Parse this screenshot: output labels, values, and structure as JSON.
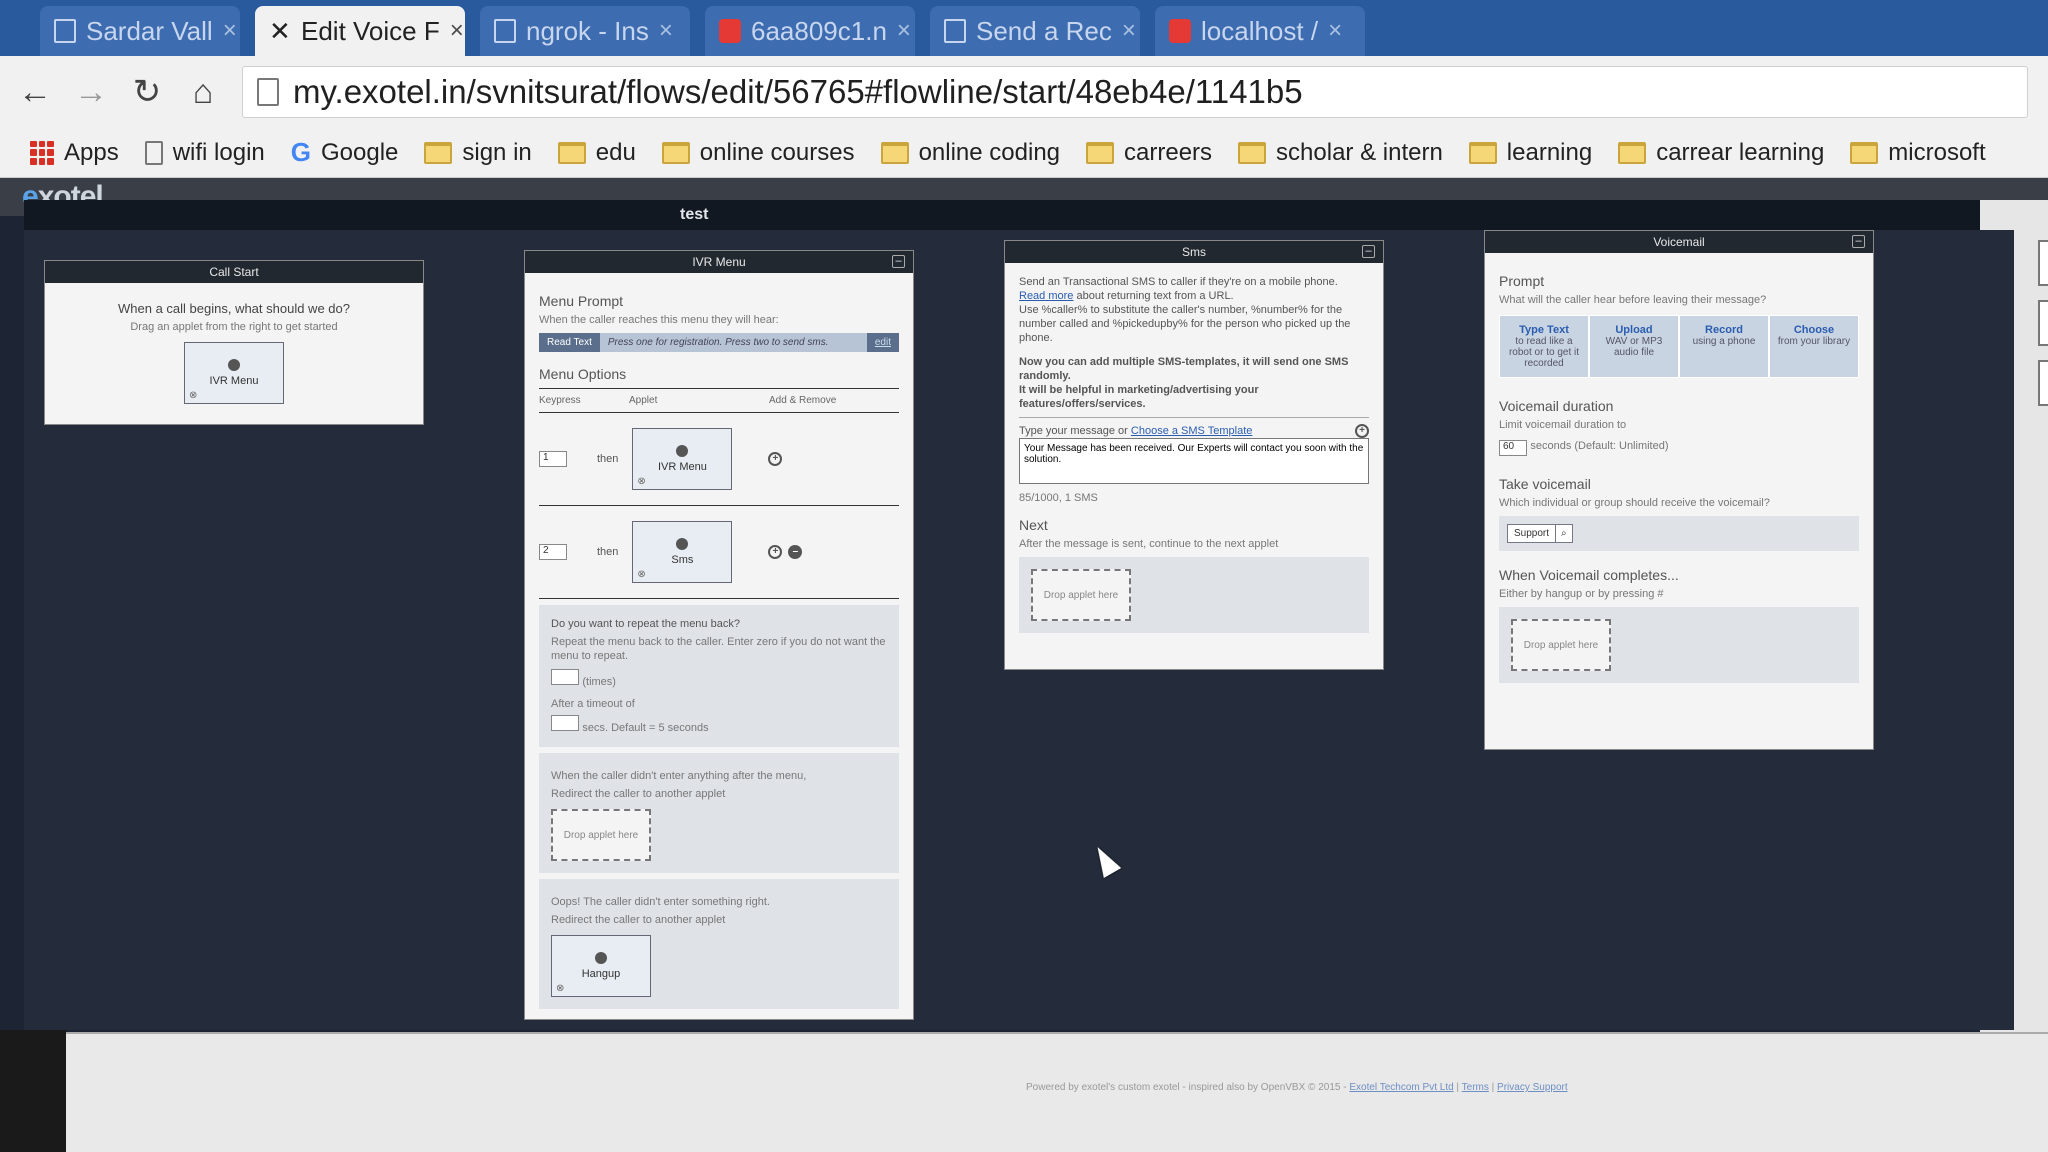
{
  "browser": {
    "tabs": [
      {
        "title": "Sardar Vall",
        "active": false
      },
      {
        "title": "Edit Voice F",
        "active": true
      },
      {
        "title": "ngrok - Ins",
        "active": false
      },
      {
        "title": "6aa809c1.n",
        "active": false
      },
      {
        "title": "Send a Rec",
        "active": false
      },
      {
        "title": "localhost /",
        "active": false
      }
    ],
    "close_glyph": "×",
    "url": "my.exotel.in/svnitsurat/flows/edit/56765#flowline/start/48eb4e/1141b5",
    "bookmarks": [
      {
        "label": "Apps",
        "icon": "apps-icon"
      },
      {
        "label": "wifi login",
        "icon": "page-icon"
      },
      {
        "label": "Google",
        "icon": "google-icon"
      },
      {
        "label": "sign in",
        "icon": "folder-icon"
      },
      {
        "label": "edu",
        "icon": "folder-icon"
      },
      {
        "label": "online courses",
        "icon": "folder-icon"
      },
      {
        "label": "online coding",
        "icon": "folder-icon"
      },
      {
        "label": "carreers",
        "icon": "folder-icon"
      },
      {
        "label": "scholar & intern",
        "icon": "folder-icon"
      },
      {
        "label": "learning",
        "icon": "folder-icon"
      },
      {
        "label": "carrear learning",
        "icon": "folder-icon"
      },
      {
        "label": "microsoft",
        "icon": "folder-icon"
      }
    ]
  },
  "app": {
    "logo_prefix": "e",
    "logo_rest": "xotel",
    "flow_name": "test"
  },
  "call_start": {
    "title": "Call Start",
    "question": "When a call begins, what should we do?",
    "hint": "Drag an applet from the right to get started",
    "applet": "IVR Menu"
  },
  "ivr": {
    "title": "IVR Menu",
    "prompt_title": "Menu Prompt",
    "prompt_sub": "When the caller reaches this menu they will hear:",
    "prompt_mode": "Read Text",
    "prompt_text": "Press one for registration. Press two to send sms.",
    "prompt_edit": "edit",
    "options_title": "Menu Options",
    "col_keypress": "Keypress",
    "col_applet": "Applet",
    "col_add": "Add & Remove",
    "then": "then",
    "options": [
      {
        "key": "1",
        "applet": "IVR Menu"
      },
      {
        "key": "2",
        "applet": "Sms"
      }
    ],
    "repeat_q": "Do you want to repeat the menu back?",
    "repeat_sub": "Repeat the menu back to the caller. Enter zero if you do not want the menu to repeat.",
    "repeat_unit": "(times)",
    "timeout_label": "After a timeout of",
    "timeout_unit": "secs. Default = 5 seconds",
    "noinput_label": "When the caller didn't enter anything after the menu,",
    "noinput_sub": "Redirect the caller to another applet",
    "drop_label": "Drop applet here",
    "oops_label": "Oops! The caller didn't enter something right.",
    "oops_sub": "Redirect the caller to another applet",
    "hangup_applet": "Hangup"
  },
  "sms": {
    "title": "Sms",
    "intro": "Send an Transactional SMS to caller if they're on a mobile phone.",
    "read_more": "Read more",
    "read_more_rest": "about returning text from a URL.",
    "vars": "Use %caller% to substitute the caller's number, %number% for the number called and %pickedupby% for the person who picked up the phone.",
    "notice_1": "Now you can add multiple SMS-templates, it will send one SMS randomly.",
    "notice_2": "It will be helpful in marketing/advertising your features/offers/services.",
    "type_label": "Type your message or",
    "template_link": "Choose a SMS Template",
    "message": "Your Message has been received. Our Experts will contact you soon with the solution.",
    "count": "85/1000, 1 SMS",
    "next_title": "Next",
    "next_sub": "After the message is sent, continue to the next applet",
    "drop_label": "Drop applet here"
  },
  "voicemail": {
    "title": "Voicemail",
    "prompt_title": "Prompt",
    "prompt_sub": "What will the caller hear before leaving their message?",
    "options": [
      {
        "title": "Type Text",
        "sub": "to read like a robot or to get it recorded"
      },
      {
        "title": "Upload",
        "sub": "WAV or MP3 audio file"
      },
      {
        "title": "Record",
        "sub": "using a phone"
      },
      {
        "title": "Choose",
        "sub": "from your library"
      }
    ],
    "duration_title": "Voicemail duration",
    "duration_sub": "Limit voicemail duration to",
    "duration_value": "60",
    "duration_unit": "seconds (Default: Unlimited)",
    "take_title": "Take voicemail",
    "take_sub": "Which individual or group should receive the voicemail?",
    "group_value": "Support",
    "complete_title": "When Voicemail completes...",
    "complete_sub": "Either by hangup or by pressing #",
    "drop_label": "Drop applet here"
  },
  "footer": {
    "text": "Powered by exotel's custom exotel - inspired also by OpenVBX © 2015 -",
    "link1": "Exotel Techcom Pvt Ltd",
    "link2": "Terms",
    "link3": "Privacy Support"
  }
}
